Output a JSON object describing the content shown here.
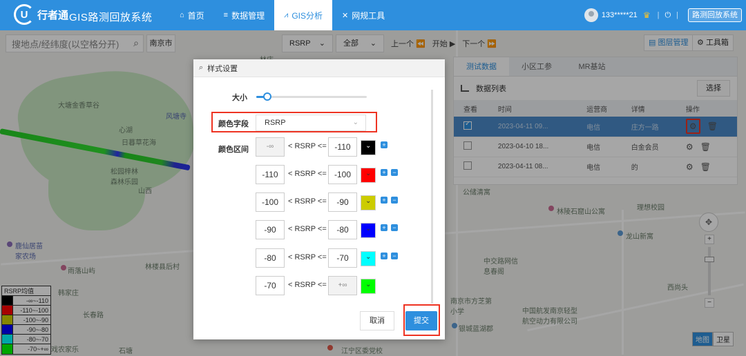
{
  "header": {
    "logo_text": "行者通",
    "system_title": "GIS路测回放系统",
    "nav": [
      {
        "label": "首页",
        "icon": "home-icon"
      },
      {
        "label": "数据管理",
        "icon": "database-icon"
      },
      {
        "label": "GIS分析",
        "icon": "chart-icon"
      },
      {
        "label": "网规工具",
        "icon": "tools-icon"
      }
    ],
    "user": "133*****21",
    "sys_button": "路测回放系统"
  },
  "map": {
    "search_placeholder": "搜地点/经纬度(以空格分开)",
    "city": "南京市",
    "metric_select": "RSRP",
    "scope_select": "全部",
    "prev": "上一个",
    "start": "开始",
    "next": "下一个",
    "layer_btn": "图层管理",
    "tool_btn": "工具箱",
    "labels": [
      "大塘金香草谷",
      "风塘寺",
      "心湖",
      "日暮草花海",
      "松园梓林森林乐园",
      "山西",
      "雨落山屿",
      "鹿仙居苗家农场",
      "林楼县后村",
      "韩家庄",
      "石塘",
      "长春路",
      "江宁区委党校",
      "林陵石窟山公寓",
      "龙山新寓",
      "理想校园",
      "中交路网信息春阁",
      "南京市方芝第小学",
      "中国航发南京轻型航空动力有限公司",
      "银城蓝湖郡",
      "西尚头",
      "驰戏农家乐",
      "林庄",
      "公储清寓"
    ],
    "map_type": [
      "地图",
      "卫星"
    ]
  },
  "panel": {
    "tabs": [
      "测试数据",
      "小区工参",
      "MR基站"
    ],
    "list_title": "数据列表",
    "select_btn": "选择",
    "columns": [
      "查看",
      "时间",
      "运营商",
      "详情",
      "操作"
    ],
    "rows": [
      {
        "time": "2023-04-11 09...",
        "operator": "电信",
        "detail": "庄方一路",
        "checked": true
      },
      {
        "time": "2023-04-10 18...",
        "operator": "电信",
        "detail": "白金会员",
        "checked": false
      },
      {
        "time": "2023-04-11 08...",
        "operator": "电信",
        "detail": "的",
        "checked": false
      }
    ]
  },
  "legend": {
    "title": "RSRP均值",
    "items": [
      {
        "label": "-∞~-110",
        "color": "#000000"
      },
      {
        "label": "-110~-100",
        "color": "#ff0000"
      },
      {
        "label": "-100~-90",
        "color": "#cccc00"
      },
      {
        "label": "-90~-80",
        "color": "#0000ff"
      },
      {
        "label": "-80~-70",
        "color": "#00ffff"
      },
      {
        "label": "-70~+∞",
        "color": "#00ff00"
      }
    ]
  },
  "dialog": {
    "title": "样式设置",
    "size_label": "大小",
    "size_value_fraction": 0.1,
    "color_field_label": "颜色字段",
    "color_field_value": "RSRP",
    "interval_label": "颜色区间",
    "ranges": [
      {
        "low": "-∞",
        "high": "-110",
        "color": "#000000"
      },
      {
        "low": "-110",
        "high": "-100",
        "color": "#ff0000"
      },
      {
        "low": "-100",
        "high": "-90",
        "color": "#cccc00"
      },
      {
        "low": "-90",
        "high": "-80",
        "color": "#0000ff"
      },
      {
        "low": "-80",
        "high": "-70",
        "color": "#00ffff"
      },
      {
        "low": "-70",
        "high": "+∞",
        "color": "#00ff00"
      }
    ],
    "mid_text": "< RSRP <=",
    "cancel": "取消",
    "submit": "提交"
  }
}
